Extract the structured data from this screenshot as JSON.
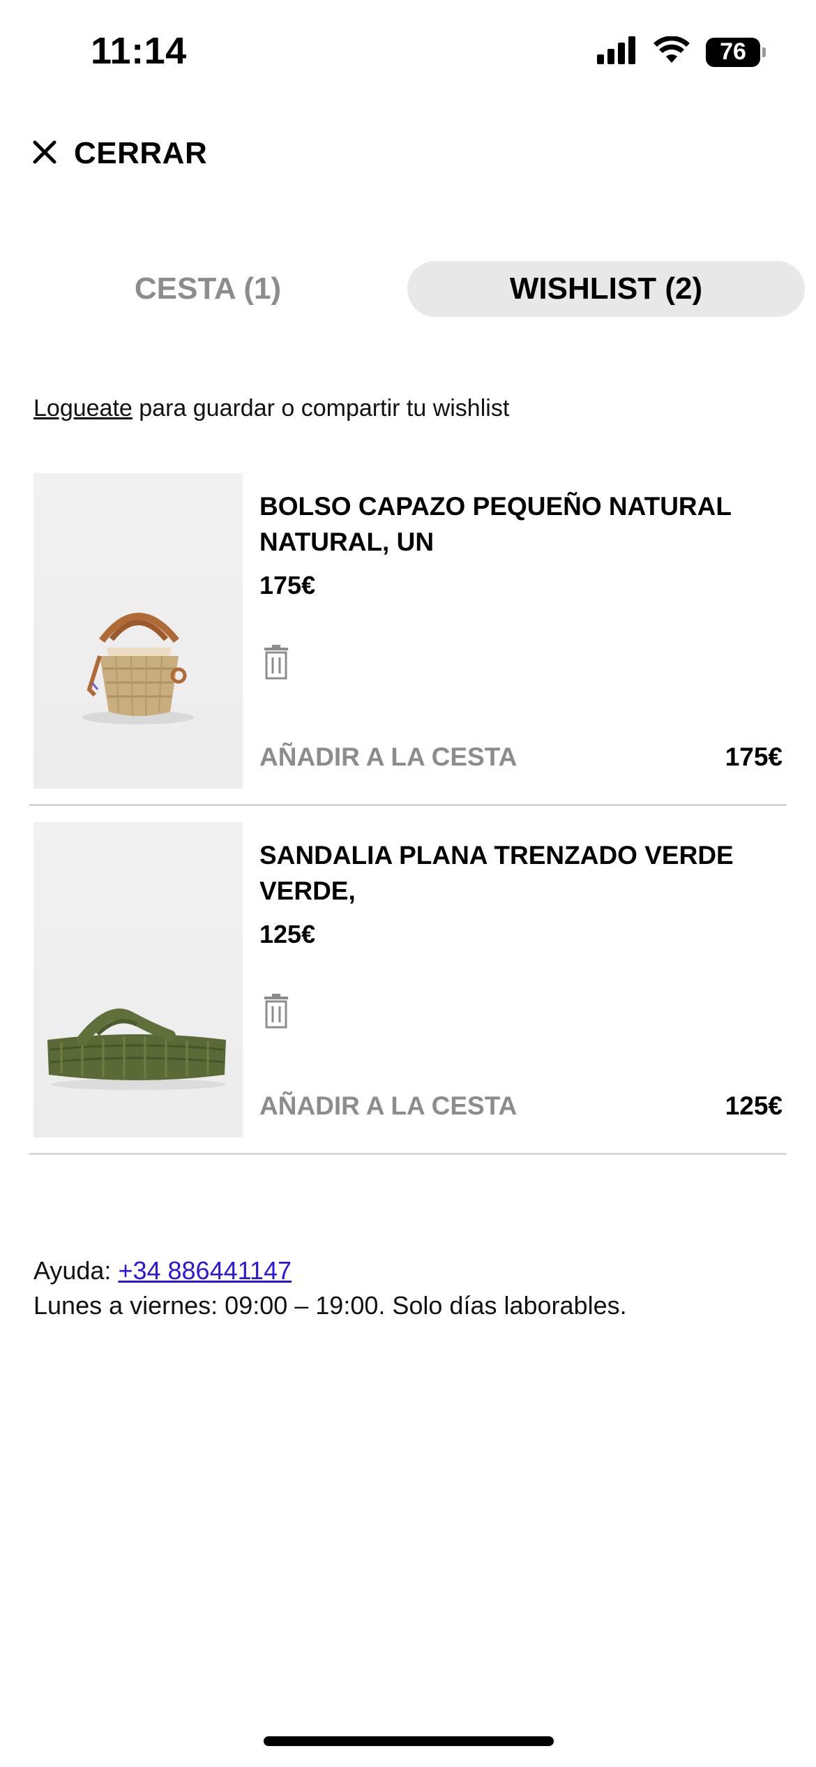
{
  "status_bar": {
    "time": "11:14",
    "battery": "76",
    "icons": [
      "signal-icon",
      "wifi-icon",
      "battery-icon"
    ]
  },
  "header": {
    "close_label": "CERRAR",
    "close_icon": "close-icon"
  },
  "tabs": [
    {
      "label": "CESTA (1)",
      "active": false
    },
    {
      "label": "WISHLIST (2)",
      "active": true
    }
  ],
  "login_notice": {
    "link": "Logueate",
    "text": " para guardar o compartir tu wishlist"
  },
  "wishlist": [
    {
      "name": "BOLSO CAPAZO PEQUEÑO NATURAL NATURAL, UN",
      "price": "175€",
      "add_label": "AÑADIR A LA CESTA",
      "line_price": "175€"
    },
    {
      "name": "SANDALIA PLANA TRENZADO VERDE VERDE,",
      "price": "125€",
      "add_label": "AÑADIR A LA CESTA",
      "line_price": "125€"
    }
  ],
  "help": {
    "label": "Ayuda: ",
    "phone": "+34 886441147",
    "hours": "Lunes a viernes: 09:00 – 19:00. Solo días laborables."
  },
  "colors": {
    "muted_text": "#8c8c8c",
    "tab_active_bg": "#e8e8e8",
    "link_blue": "#2a16e0",
    "divider": "#d6d6d6"
  }
}
